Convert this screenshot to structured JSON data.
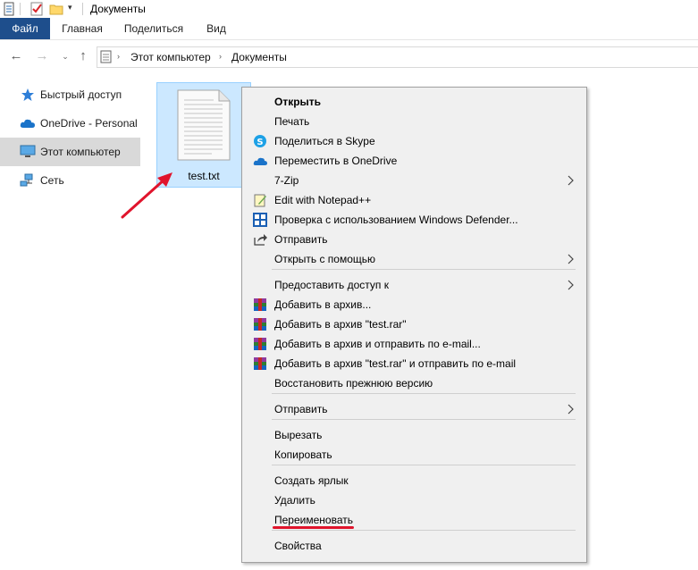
{
  "window": {
    "title": "Документы"
  },
  "ribbon": {
    "tabs": [
      "Файл",
      "Главная",
      "Поделиться",
      "Вид"
    ]
  },
  "breadcrumb": [
    "Этот компьютер",
    "Документы"
  ],
  "sidebar": {
    "items": [
      {
        "label": "Быстрый доступ",
        "icon": "star-icon"
      },
      {
        "label": "OneDrive - Personal",
        "icon": "cloud-icon"
      },
      {
        "label": "Этот компьютер",
        "icon": "computer-icon",
        "selected": true
      },
      {
        "label": "Сеть",
        "icon": "network-icon"
      }
    ]
  },
  "file": {
    "name": "test.txt",
    "icon": "text-file-icon"
  },
  "context_menu": {
    "items": [
      {
        "label": "Открыть",
        "bold": true
      },
      {
        "label": "Печать"
      },
      {
        "label": "Поделиться в Skype",
        "icon": "skype-icon"
      },
      {
        "label": "Переместить в OneDrive",
        "icon": "onedrive-icon"
      },
      {
        "label": "7-Zip",
        "submenu": true
      },
      {
        "label": "Edit with Notepad++",
        "icon": "notepadpp-icon"
      },
      {
        "label": "Проверка с использованием Windows Defender...",
        "icon": "defender-icon"
      },
      {
        "label": "Отправить",
        "icon": "share-icon"
      },
      {
        "label": "Открыть с помощью",
        "submenu": true
      },
      {
        "label": "Предоставить доступ к",
        "submenu": true
      },
      {
        "label": "Добавить в архив...",
        "icon": "winrar-icon"
      },
      {
        "label": "Добавить в архив \"test.rar\"",
        "icon": "winrar-icon"
      },
      {
        "label": "Добавить в архив и отправить по e-mail...",
        "icon": "winrar-icon"
      },
      {
        "label": "Добавить в архив \"test.rar\" и отправить по e-mail",
        "icon": "winrar-icon"
      },
      {
        "label": "Восстановить прежнюю версию"
      },
      {
        "label": "Отправить",
        "submenu": true
      },
      {
        "label": "Вырезать"
      },
      {
        "label": "Копировать"
      },
      {
        "label": "Создать ярлык"
      },
      {
        "label": "Удалить"
      },
      {
        "label": "Переименовать",
        "highlighted": true
      },
      {
        "label": "Свойства"
      }
    ]
  },
  "colors": {
    "accent": "#1e4e8c",
    "selection": "#cce8ff",
    "annotation": "#e0142c"
  }
}
